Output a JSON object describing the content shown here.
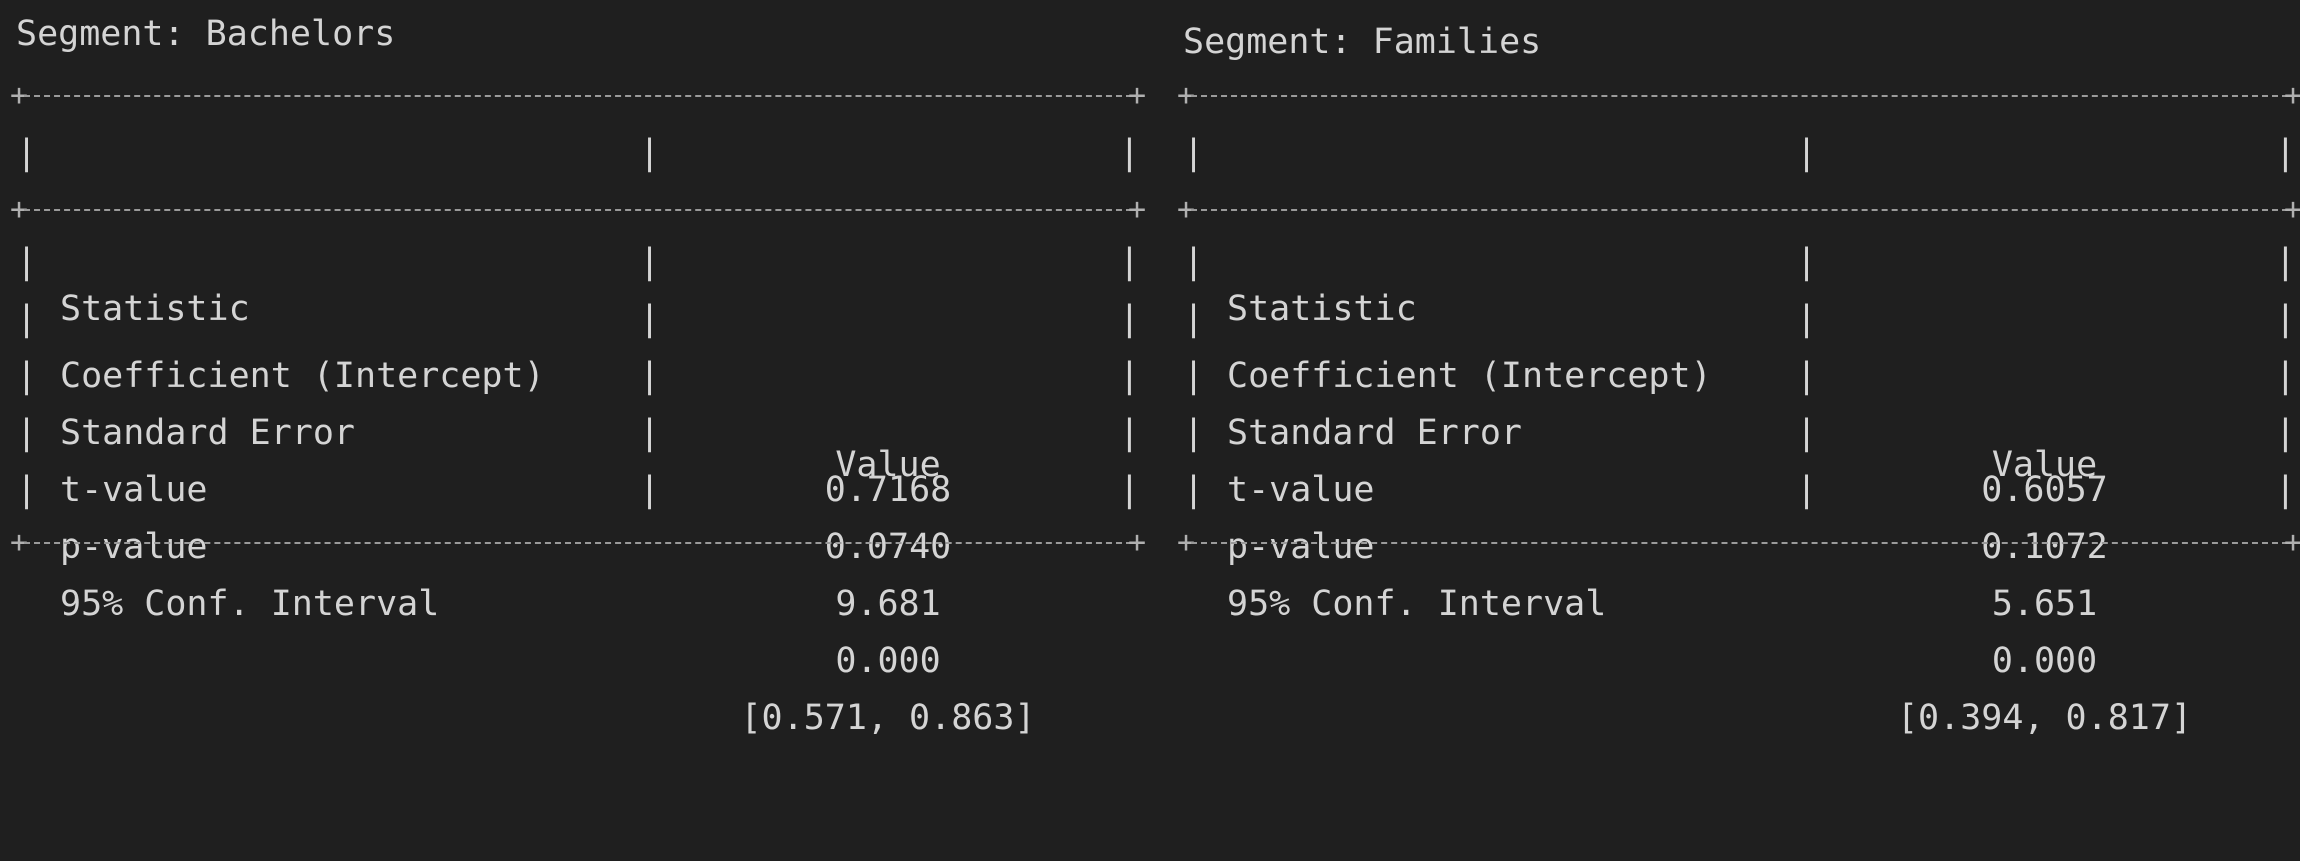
{
  "segments": [
    {
      "title": "Segment: Bachelors",
      "headers": {
        "statistic": "Statistic",
        "value": "Value"
      },
      "rows": [
        {
          "statistic": "Coefficient (Intercept)",
          "value": "0.7168"
        },
        {
          "statistic": "Standard Error",
          "value": "0.0740"
        },
        {
          "statistic": "t-value",
          "value": "9.681"
        },
        {
          "statistic": "p-value",
          "value": "0.000"
        },
        {
          "statistic": "95% Conf. Interval",
          "value": "[0.571, 0.863]"
        }
      ]
    },
    {
      "title": "Segment: Families",
      "headers": {
        "statistic": "Statistic",
        "value": "Value"
      },
      "rows": [
        {
          "statistic": "Coefficient (Intercept)",
          "value": "0.6057"
        },
        {
          "statistic": "Standard Error",
          "value": "0.1072"
        },
        {
          "statistic": "t-value",
          "value": "5.651"
        },
        {
          "statistic": "p-value",
          "value": "0.000"
        },
        {
          "statistic": "95% Conf. Interval",
          "value": "[0.394, 0.817]"
        }
      ]
    }
  ],
  "glyphs": {
    "corner": "+",
    "bar": "|"
  }
}
